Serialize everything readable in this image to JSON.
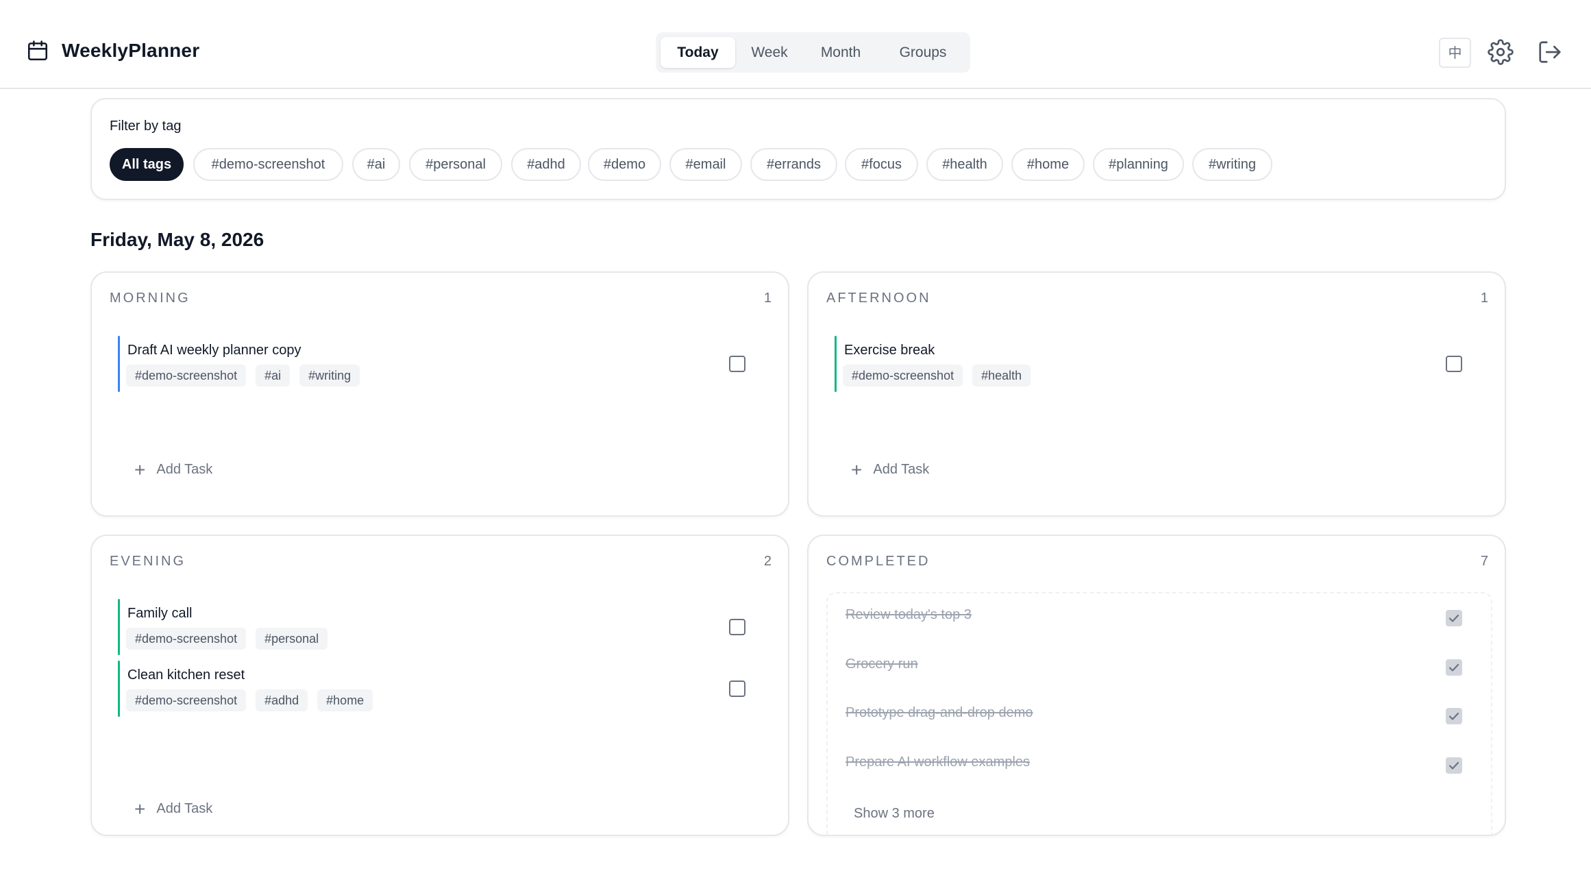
{
  "app": {
    "name": "WeeklyPlanner",
    "logo_icon": "calendar-icon",
    "lang_label": "中"
  },
  "nav": {
    "tabs": [
      {
        "label": "Today",
        "active": true
      },
      {
        "label": "Week",
        "active": false
      },
      {
        "label": "Month",
        "active": false
      },
      {
        "label": "Groups",
        "active": false
      }
    ]
  },
  "header_icons": [
    "settings-gear-icon",
    "logout-icon"
  ],
  "filter": {
    "label": "Filter by tag",
    "chips": [
      {
        "label": "All tags",
        "active": true
      },
      {
        "label": "#demo-screenshot",
        "active": false
      },
      {
        "label": "#ai",
        "active": false
      },
      {
        "label": "#personal",
        "active": false
      },
      {
        "label": "#adhd",
        "active": false
      },
      {
        "label": "#demo",
        "active": false
      },
      {
        "label": "#email",
        "active": false
      },
      {
        "label": "#errands",
        "active": false
      },
      {
        "label": "#focus",
        "active": false
      },
      {
        "label": "#health",
        "active": false
      },
      {
        "label": "#home",
        "active": false
      },
      {
        "label": "#planning",
        "active": false
      },
      {
        "label": "#writing",
        "active": false
      }
    ]
  },
  "date_heading": "Friday, May 8, 2026",
  "sections": {
    "morning": {
      "title": "MORNING",
      "count": "1",
      "tasks": [
        {
          "title": "Draft AI weekly planner copy",
          "tags": [
            "#demo-screenshot",
            "#ai",
            "#writing"
          ],
          "accent": "#3b82f6",
          "checked": false
        }
      ],
      "add_label": "Add Task"
    },
    "afternoon": {
      "title": "AFTERNOON",
      "count": "1",
      "tasks": [
        {
          "title": "Exercise break",
          "tags": [
            "#demo-screenshot",
            "#health"
          ],
          "accent": "#10b981",
          "checked": false
        }
      ],
      "add_label": "Add Task"
    },
    "evening": {
      "title": "EVENING",
      "count": "2",
      "tasks": [
        {
          "title": "Family call",
          "tags": [
            "#demo-screenshot",
            "#personal"
          ],
          "accent": "#10b981",
          "checked": false
        },
        {
          "title": "Clean kitchen reset",
          "tags": [
            "#demo-screenshot",
            "#adhd",
            "#home"
          ],
          "accent": "#10b981",
          "checked": false
        }
      ],
      "add_label": "Add Task"
    },
    "completed": {
      "title": "COMPLETED",
      "count": "7",
      "items": [
        {
          "title": "Review today's top 3",
          "checked": true
        },
        {
          "title": "Grocery run",
          "checked": true
        },
        {
          "title": "Prototype drag-and-drop demo",
          "checked": true
        },
        {
          "title": "Prepare AI workflow examples",
          "checked": true
        }
      ],
      "show_more": "Show 3 more"
    }
  },
  "colors": {
    "primary": "#111827",
    "border": "#e5e7eb",
    "muted": "#6b7280",
    "morning_accent": "#3b82f6",
    "green_accent": "#10b981"
  }
}
